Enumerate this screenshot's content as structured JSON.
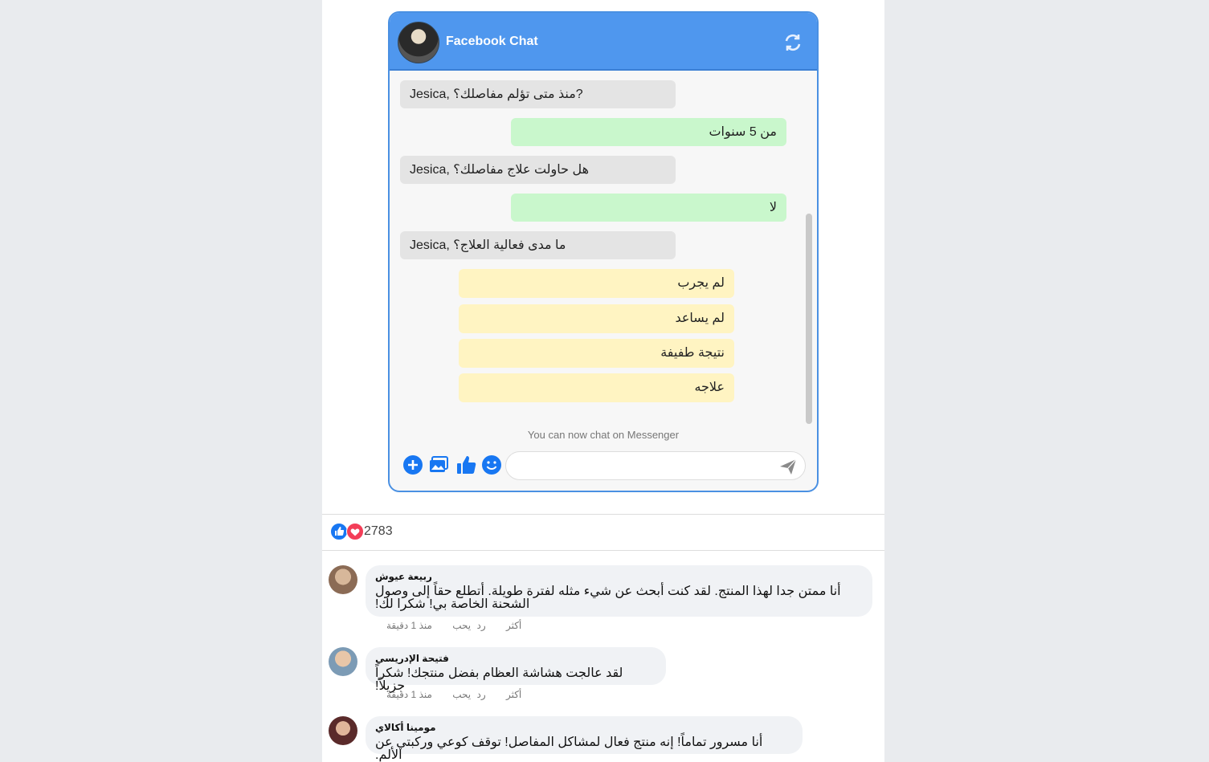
{
  "chat": {
    "title": "Facebook Chat",
    "messages": [
      {
        "from": "bot",
        "text": "Jesica, منذ متى تؤلم مفاصلك؟?"
      },
      {
        "from": "user",
        "text": "من 5 سنوات"
      },
      {
        "from": "bot",
        "text": "Jesica, هل حاولت علاج مفاصلك؟"
      },
      {
        "from": "user",
        "text": "لا"
      },
      {
        "from": "bot",
        "text": "Jesica, ما مدى فعالية العلاج؟"
      }
    ],
    "options": [
      "لم يجرب",
      "لم يساعد",
      "نتيجة طفيفة",
      "علاجه"
    ],
    "hint": "You can now chat on Messenger",
    "input_placeholder": ""
  },
  "reactions": {
    "count": "2783"
  },
  "comments": [
    {
      "name": "ربيعة عيوش",
      "text": "أنا ممتن جدا لهذا المنتج. لقد كنت أبحث عن شيء مثله لفترة طويلة. أتطلع حقاً إلى وصول الشحنة الخاصة بي! شكرا لك!",
      "time": "منذ 1 دقيقة",
      "like": "يحب",
      "reply": "رد",
      "more": "أكثر"
    },
    {
      "name": "فتيحة الإدريسي",
      "text": "لقد عالجت هشاشة العظام بفضل منتجك! شكراً جزيلاً!",
      "time": "منذ 1 دقيقة",
      "like": "يحب",
      "reply": "رد",
      "more": "أكثر"
    },
    {
      "name": "مومينا أكالاي",
      "text": "أنا مسرور تماماً! إنه منتج فعال لمشاكل المفاصل! توقف كوعي وركبتي عن الألم."
    }
  ],
  "colors": {
    "header": "#4f97ee",
    "bot_bubble": "#e4e4e4",
    "user_bubble": "#c9f7cc",
    "option_bubble": "#fff4c2",
    "accent": "#1877f2"
  }
}
